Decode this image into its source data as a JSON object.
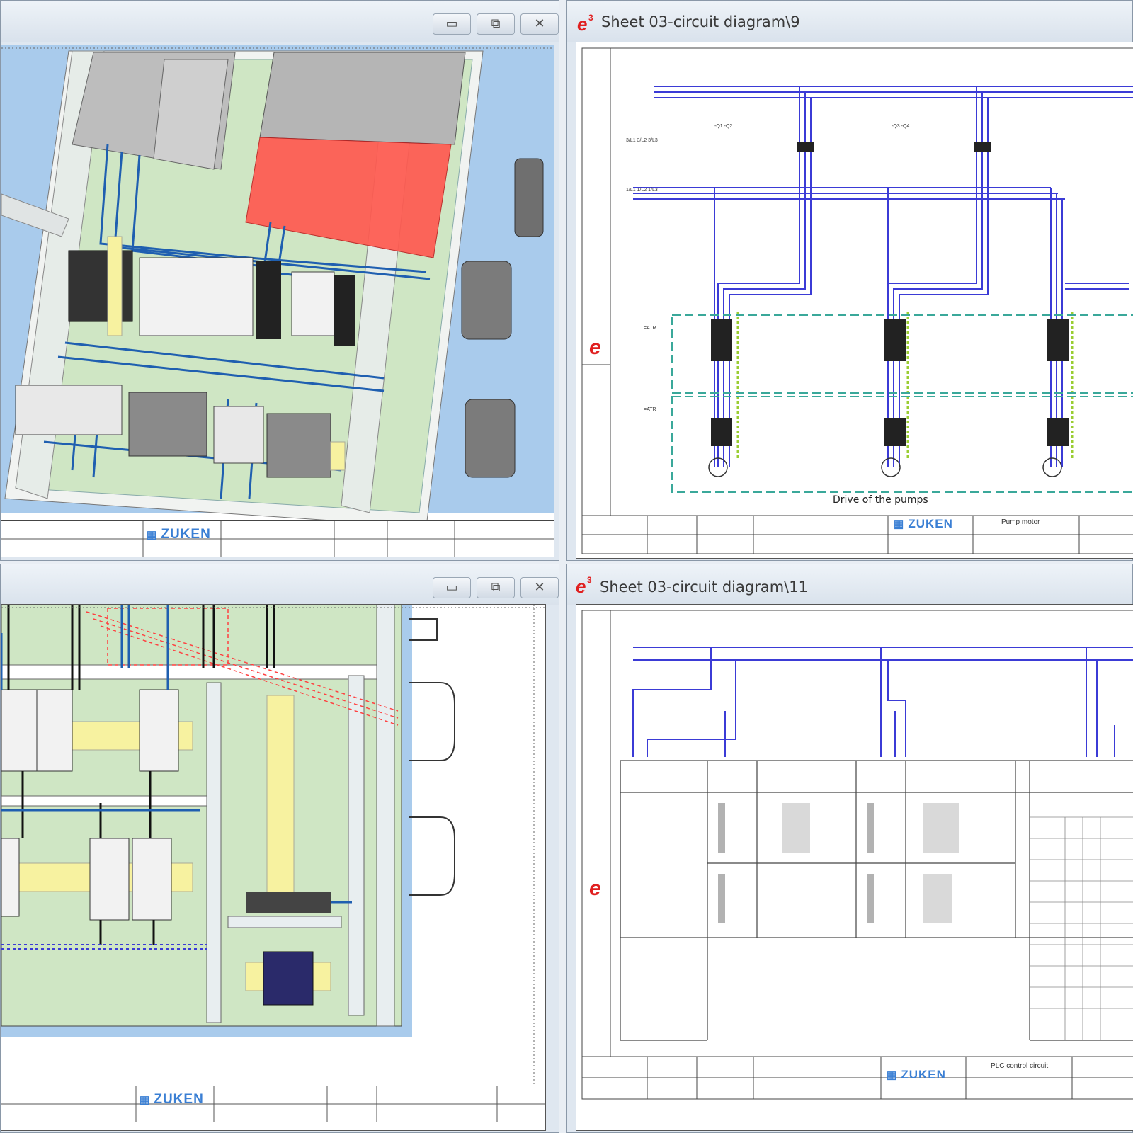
{
  "windows": {
    "top_left": {
      "controls": {
        "minimize": "▭",
        "maximize": "⧉",
        "close": "✕"
      }
    },
    "top_right": {
      "title": "Sheet 03-circuit diagram\\9",
      "caption": "Drive of the pumps",
      "logo": "ZUKEN",
      "title_block": "Pump motor"
    },
    "bottom_left": {
      "controls": {
        "minimize": "▭",
        "maximize": "⧉",
        "close": "✕"
      }
    },
    "bottom_right": {
      "title": "Sheet 03-circuit diagram\\11",
      "logo": "ZUKEN",
      "title_block": "PLC control circuit"
    }
  },
  "logos": {
    "top_left": "ZUKEN",
    "bottom_left": "ZUKEN"
  },
  "colors": {
    "accent": "#3a7fd4",
    "wire_blue": "#3b3bd6",
    "panel_green": "#cfe6c4",
    "cabinet_blue": "#a9cbec",
    "red_module": "#ff5a50",
    "yellow_rail": "#f7f2a0"
  }
}
